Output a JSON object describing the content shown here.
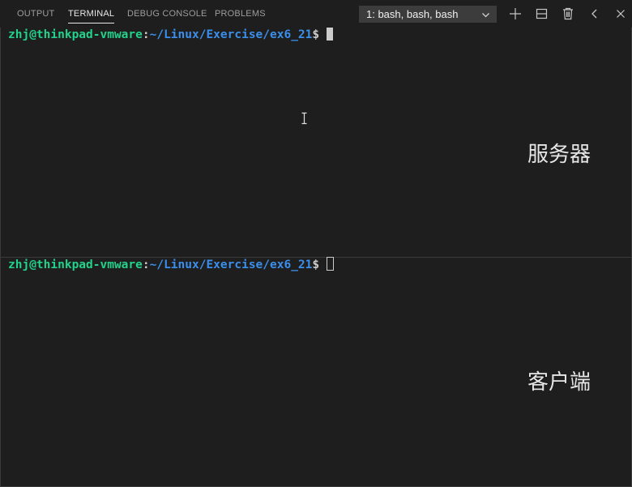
{
  "panel": {
    "tabs": [
      "OUTPUT",
      "TERMINAL",
      "DEBUG CONSOLE",
      "PROBLEMS"
    ],
    "active_tab": "TERMINAL",
    "terminal_select": "1: bash, bash, bash"
  },
  "terminals": [
    {
      "user_host": "zhj@thinkpad-vmware",
      "colon": ":",
      "path": "~/Linux/Exercise/ex6_21",
      "dollar": "$",
      "annotation": "服务器"
    },
    {
      "user_host": "zhj@thinkpad-vmware",
      "colon": ":",
      "path": "~/Linux/Exercise/ex6_21",
      "dollar": "$",
      "annotation": "客户端"
    }
  ],
  "icons": {
    "chevron": "chevron-down-icon",
    "add": "plus-icon",
    "split": "split-terminal-icon",
    "kill": "trash-icon",
    "maximize": "chevron-left-icon",
    "close": "close-icon"
  },
  "colors": {
    "background": "#1e1e1e",
    "user_host": "#23d18b",
    "path": "#3b8eea",
    "text": "#cccccc"
  }
}
